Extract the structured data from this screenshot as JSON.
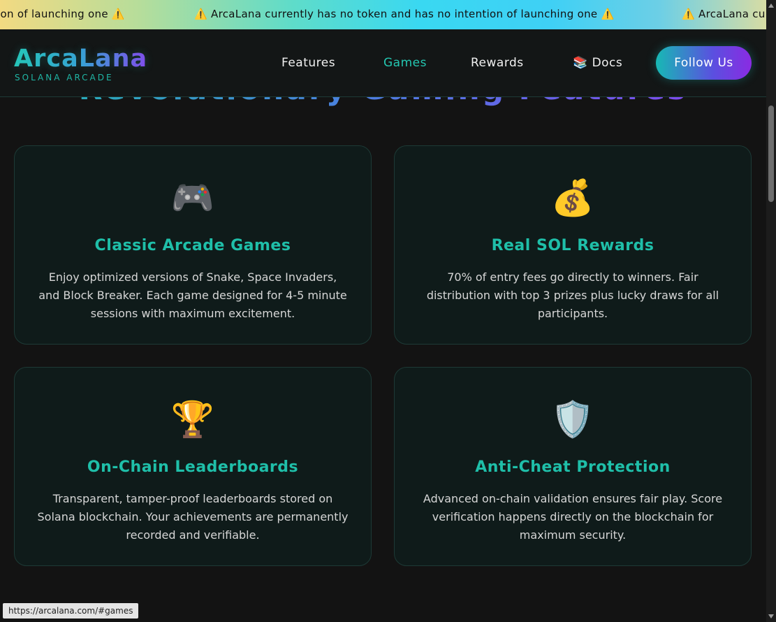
{
  "ticker": {
    "fragment": "ion of launching one ⚠️",
    "message": "⚠️ ArcaLana currently has no token and has no intention of launching one ⚠️",
    "tail": "⚠️ ArcaLana cu"
  },
  "header": {
    "logo": "ArcaLana",
    "logo_sub": "SOLANA ARCADE",
    "nav": [
      {
        "label": "Features"
      },
      {
        "label": "Games"
      },
      {
        "label": "Rewards"
      },
      {
        "label": "📚 Docs"
      }
    ],
    "follow_label": "Follow Us"
  },
  "section": {
    "heading": "Revolutionary Gaming Features"
  },
  "cards": [
    {
      "icon": "🎮",
      "icon_name": "gamepad-icon",
      "title": "Classic Arcade Games",
      "desc": "Enjoy optimized versions of Snake, Space Invaders, and Block Breaker. Each game designed for 4-5 minute sessions with maximum excitement."
    },
    {
      "icon": "💰",
      "icon_name": "money-bag-icon",
      "title": "Real SOL Rewards",
      "desc": "70% of entry fees go directly to winners. Fair distribution with top 3 prizes plus lucky draws for all participants."
    },
    {
      "icon": "🏆",
      "icon_name": "trophy-icon",
      "title": "On-Chain Leaderboards",
      "desc": "Transparent, tamper-proof leaderboards stored on Solana blockchain. Your achievements are permanently recorded and verifiable."
    },
    {
      "icon": "🛡️",
      "icon_name": "shield-icon",
      "title": "Anti-Cheat Protection",
      "desc": "Advanced on-chain validation ensures fair play. Score verification happens directly on the blockchain for maximum security."
    }
  ],
  "status_url": "https://arcalana.com/#games",
  "colors": {
    "accent": "#1fbfa9",
    "purple": "#8a2be2",
    "background": "#131313",
    "card_bg": "#0f1b1a"
  }
}
